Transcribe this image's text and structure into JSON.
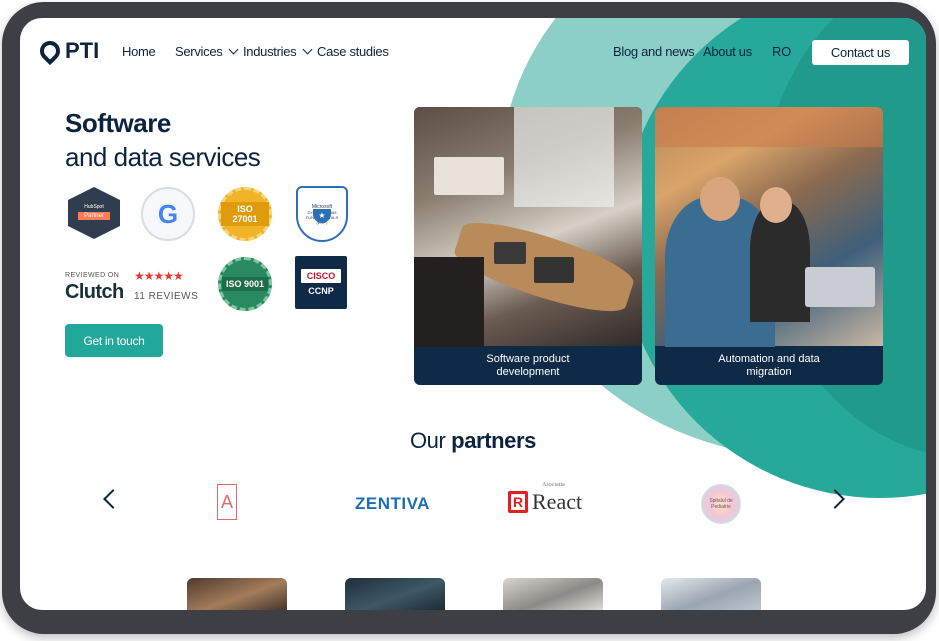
{
  "nav": {
    "logo": "PTI",
    "home": "Home",
    "services": "Services",
    "industries": "Industries",
    "case_studies": "Case studies",
    "blog": "Blog and news",
    "about": "About us",
    "lang": "RO",
    "contact": "Contact us"
  },
  "hero": {
    "title": "Software",
    "subtitle": "and data services",
    "cta": "Get in touch",
    "badges": {
      "hubspot_top": "HubSpot",
      "hubspot_partner": "Partner",
      "google": "G",
      "iso27001": "ISO 27001",
      "microsoft_top": "Microsoft",
      "microsoft_sub": "DYNAMICS 365 FUNDAMENTALS (ERP)",
      "clutch_reviewed": "REVIEWED ON",
      "clutch_stars": "★★★★★",
      "clutch_name": "Clutch",
      "clutch_reviews": "11 REVIEWS",
      "iso9001": "ISO 9001",
      "cisco": "CISCO",
      "ccnp": "CCNP"
    }
  },
  "cards": [
    {
      "label": "Software product development"
    },
    {
      "label": "Automation and data migration"
    }
  ],
  "partners": {
    "title_light": "Our",
    "title_bold": "partners",
    "logos": {
      "a_logo": "A",
      "zentiva": "ZENTIVA",
      "react_prefix": "Asociatia",
      "react": "React",
      "react_mark": "R",
      "spital": "Spitalul de Pediatrie"
    }
  },
  "colors": {
    "navy": "#0c2340",
    "teal": "#21a89a",
    "teal_light": "#8ccfc6"
  }
}
